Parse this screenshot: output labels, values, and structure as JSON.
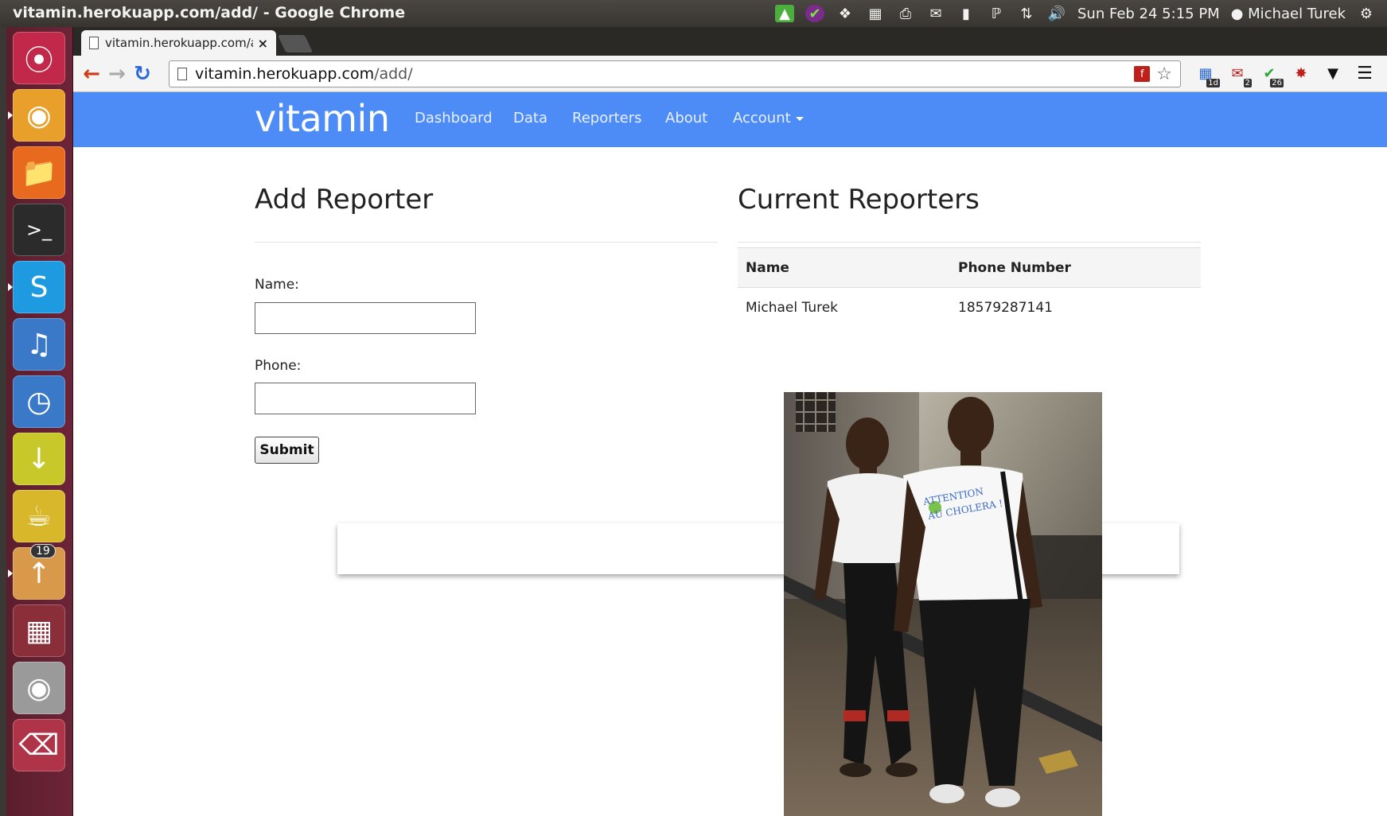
{
  "window": {
    "title": "vitamin.herokuapp.com/add/ - Google Chrome"
  },
  "tray": {
    "clock": "Sun Feb 24  5:15 PM",
    "user": "Michael Turek"
  },
  "launcher": {
    "upload_badge": "19"
  },
  "browser": {
    "tab_title": "vitamin.herokuapp.com/a",
    "tab_close": "×",
    "url_host": "vitamin.herokuapp.com",
    "url_path": "/add/",
    "ext_calendar_num": "1d",
    "ext_gmail_num": "2",
    "ext_check_num": "26"
  },
  "navbar": {
    "brand": "vitamin",
    "links": [
      "Dashboard",
      "Data",
      "Reporters",
      "About",
      "Account"
    ]
  },
  "add_reporter": {
    "heading": "Add Reporter",
    "name_label": "Name:",
    "name_value": "",
    "phone_label": "Phone:",
    "phone_value": "",
    "submit_label": "Submit"
  },
  "current_reporters": {
    "heading": "Current Reporters",
    "columns": [
      "Name",
      "Phone Number"
    ],
    "rows": [
      {
        "name": "Michael Turek",
        "phone": "18579287141"
      }
    ]
  },
  "photo": {
    "shirt_text_1": "ATTENTION",
    "shirt_text_2": "AU CHOLERA !"
  },
  "colors": {
    "navbar": "#4d8cf6",
    "launcher": "#6d2438"
  }
}
